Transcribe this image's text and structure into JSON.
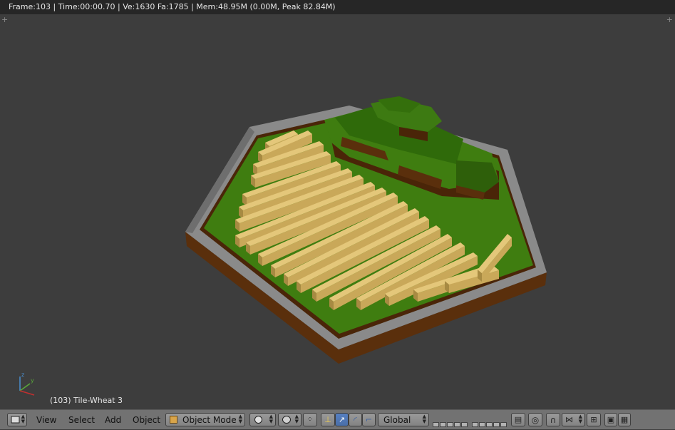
{
  "render_info": "Frame:103 | Time:00:00.70 | Ve:1630 Fa:1785 | Mem:48.95M (0.00M, Peak 82.84M)",
  "object_info": "(103) Tile-Wheat 3",
  "axis": {
    "x": "x",
    "y": "y",
    "z": "z"
  },
  "menus": {
    "view": "View",
    "select": "Select",
    "add": "Add",
    "object": "Object"
  },
  "mode": {
    "label": "Object Mode",
    "icon": "cube-icon"
  },
  "orientation": {
    "label": "Global"
  },
  "colors": {
    "viewport_bg": "#3d3d3d",
    "header_bg": "#727272",
    "grass": "#3f7d10",
    "dirt": "#5a2f0c",
    "rim": "#8c8c8c",
    "wheat": "#d8b86b",
    "active_button": "#5680c2"
  }
}
